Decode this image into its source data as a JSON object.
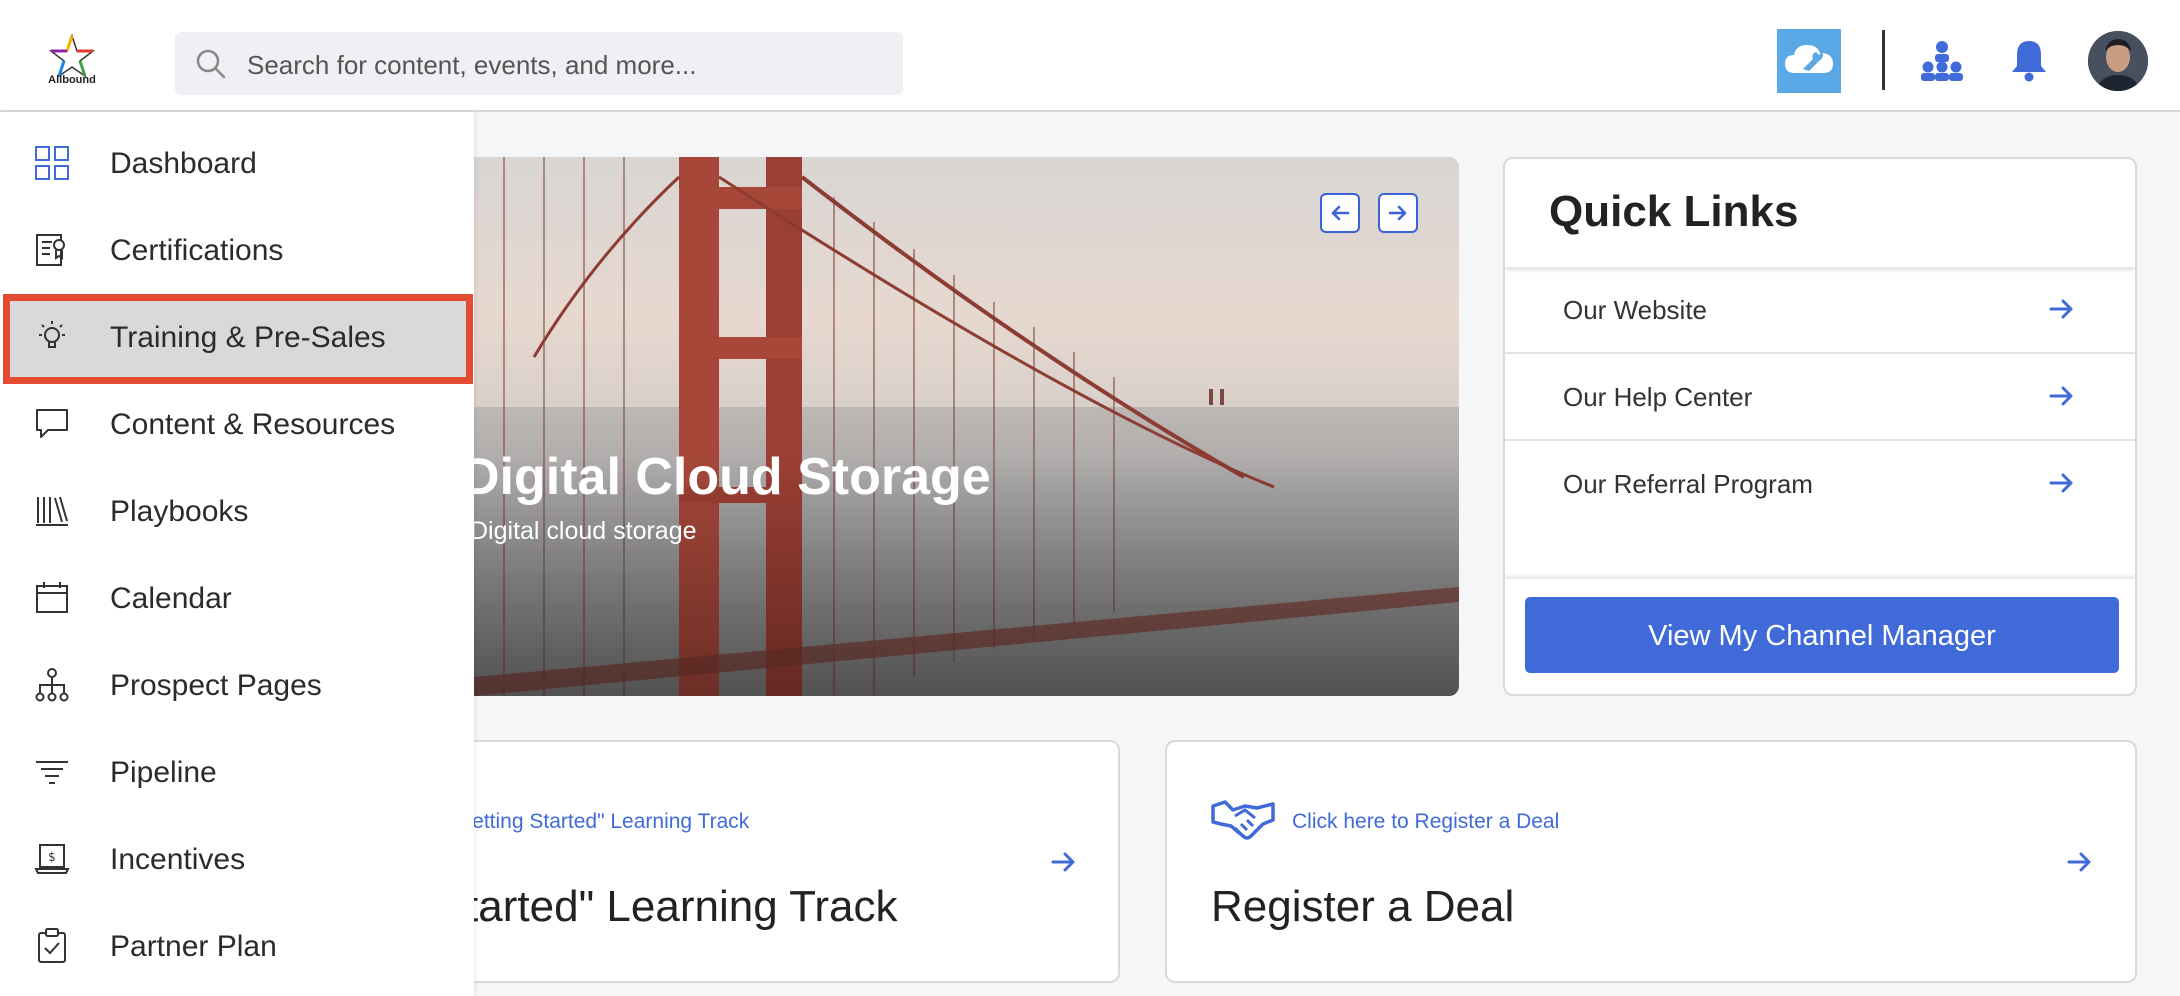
{
  "app": {
    "logo_text": "Allbound"
  },
  "search": {
    "placeholder": "Search for content, events, and more..."
  },
  "header_icons": [
    "cloud-wrench-icon",
    "org-chart-icon",
    "bell-icon",
    "user-avatar"
  ],
  "sidebar": {
    "items": [
      {
        "label": "Dashboard",
        "icon": "dashboard-grid-icon"
      },
      {
        "label": "Certifications",
        "icon": "certificate-icon"
      },
      {
        "label": "Training & Pre-Sales",
        "icon": "lightbulb-icon",
        "active": true
      },
      {
        "label": "Content & Resources",
        "icon": "chat-bubble-icon"
      },
      {
        "label": "Playbooks",
        "icon": "books-icon"
      },
      {
        "label": "Calendar",
        "icon": "calendar-icon"
      },
      {
        "label": "Prospect Pages",
        "icon": "sitemap-icon"
      },
      {
        "label": "Pipeline",
        "icon": "filter-icon"
      },
      {
        "label": "Incentives",
        "icon": "incentive-icon"
      },
      {
        "label": "Partner Plan",
        "icon": "clipboard-check-icon"
      }
    ]
  },
  "hero": {
    "title": "Digital Cloud Storage",
    "subtitle": "Digital cloud storage"
  },
  "quick_links": {
    "title": "Quick Links",
    "items": [
      "Our Website",
      "Our Help Center",
      "Our Referral Program"
    ],
    "button": "View My Channel Manager"
  },
  "cards": [
    {
      "link": "Take our \"Getting Started\" Learning Track",
      "title": "\"Getting Started\" Learning Track"
    },
    {
      "link": "Click here to Register a Deal",
      "title": "Register a Deal"
    }
  ],
  "colors": {
    "accent": "#3f6ad8",
    "highlight_border": "#e34b33",
    "active_bg": "#d9d9dc"
  }
}
